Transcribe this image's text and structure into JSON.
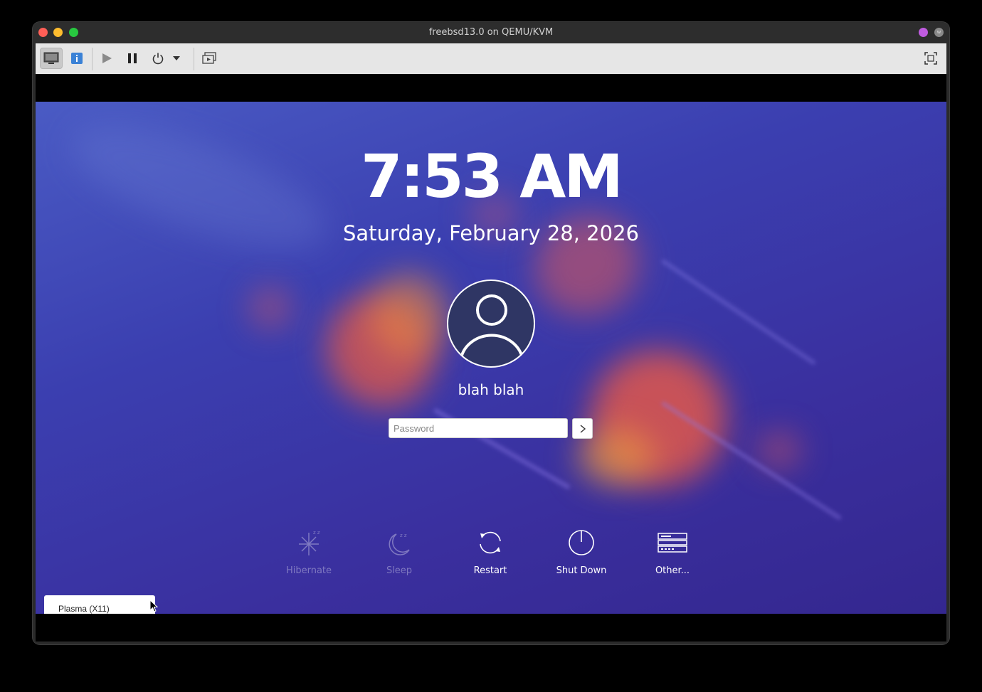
{
  "window": {
    "title": "freebsd13.0 on QEMU/KVM"
  },
  "toolbar": {
    "buttons": [
      "display-console",
      "details-info",
      "run",
      "pause",
      "shut-down",
      "shut-down-menu",
      "snapshots",
      "fullscreen"
    ]
  },
  "lockscreen": {
    "time": "7:53 AM",
    "date": "Saturday, February 28, 2026",
    "username": "blah blah",
    "password_placeholder": "Password",
    "actions": [
      {
        "label": "Hibernate",
        "enabled": false
      },
      {
        "label": "Sleep",
        "enabled": false
      },
      {
        "label": "Restart",
        "enabled": true
      },
      {
        "label": "Shut Down",
        "enabled": true
      },
      {
        "label": "Other...",
        "enabled": true
      }
    ],
    "session": "Plasma (X11)"
  },
  "colors": {
    "accent_blue": "#3b82d6",
    "traffic_red": "#ff5f57",
    "traffic_yellow": "#febc2e",
    "traffic_green": "#28c840"
  }
}
